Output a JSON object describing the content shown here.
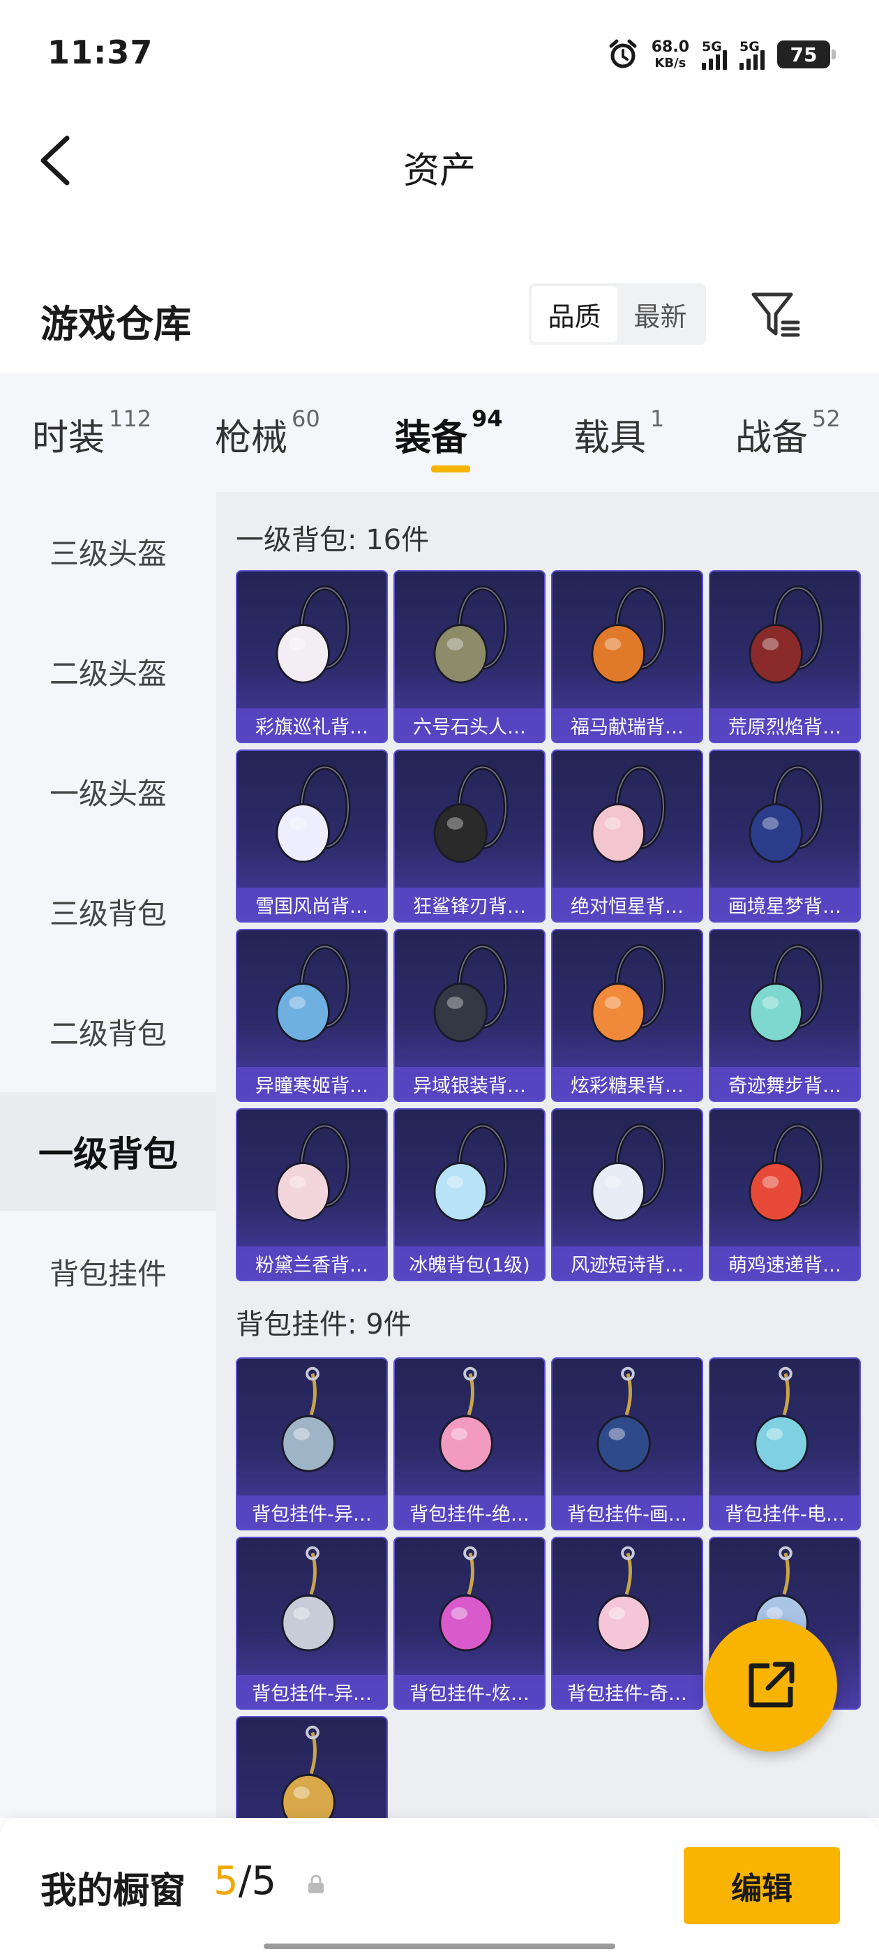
{
  "status": {
    "time": "11:37",
    "speed_value": "68.0",
    "speed_unit": "KB/s",
    "net1": "5G",
    "net2": "5G",
    "battery": "75"
  },
  "header": {
    "title": "资产"
  },
  "section": {
    "title": "游戏仓库",
    "sort_options": [
      "品质",
      "最新"
    ],
    "sort_selected": "品质"
  },
  "tabs": [
    {
      "label": "时装",
      "count": "112"
    },
    {
      "label": "枪械",
      "count": "60"
    },
    {
      "label": "装备",
      "count": "94"
    },
    {
      "label": "载具",
      "count": "1"
    },
    {
      "label": "战备",
      "count": "52"
    }
  ],
  "active_tab": "装备",
  "sidebar": [
    {
      "label": "三级头盔"
    },
    {
      "label": "二级头盔"
    },
    {
      "label": "一级头盔"
    },
    {
      "label": "三级背包"
    },
    {
      "label": "二级背包"
    },
    {
      "label": "一级背包"
    },
    {
      "label": "背包挂件"
    }
  ],
  "active_sidebar": "一级背包",
  "groups": [
    {
      "title": "一级背包: 16件",
      "items": [
        {
          "label": "彩旗巡礼背…",
          "color": "#f2eef4"
        },
        {
          "label": "六号石头人…",
          "color": "#8c8c6a"
        },
        {
          "label": "福马献瑞背…",
          "color": "#e07a2a"
        },
        {
          "label": "荒原烈焰背…",
          "color": "#8a2a2a"
        },
        {
          "label": "雪国风尚背…",
          "color": "#eeeeff"
        },
        {
          "label": "狂鲨锋刃背…",
          "color": "#2a2a2a"
        },
        {
          "label": "绝对恒星背…",
          "color": "#f3c6cf"
        },
        {
          "label": "画境星梦背…",
          "color": "#2b3c8a"
        },
        {
          "label": "异瞳寒姬背…",
          "color": "#6fb0e0"
        },
        {
          "label": "异域银装背…",
          "color": "#333844"
        },
        {
          "label": "炫彩糖果背…",
          "color": "#f08a3a"
        },
        {
          "label": "奇迹舞步背…",
          "color": "#7fd8d0"
        },
        {
          "label": "粉黛兰香背…",
          "color": "#f2d6dc"
        },
        {
          "label": "冰魄背包(1级)",
          "color": "#b8e2f6"
        },
        {
          "label": "风迹短诗背…",
          "color": "#e8ecf6"
        },
        {
          "label": "萌鸡速递背…",
          "color": "#e84a3a"
        }
      ]
    },
    {
      "title": "背包挂件: 9件",
      "items": [
        {
          "label": "背包挂件-异…",
          "color": "#9fb4c6"
        },
        {
          "label": "背包挂件-绝…",
          "color": "#f29ac0"
        },
        {
          "label": "背包挂件-画…",
          "color": "#2f4a8a"
        },
        {
          "label": "背包挂件-电…",
          "color": "#7fd0e0"
        },
        {
          "label": "背包挂件-异…",
          "color": "#c7ccd8"
        },
        {
          "label": "背包挂件-炫…",
          "color": "#d85acb"
        },
        {
          "label": "背包挂件-奇…",
          "color": "#f4c6d8"
        },
        {
          "label": "",
          "color": "#aac4e6"
        },
        {
          "label": "",
          "color": "#d8a84a"
        }
      ]
    }
  ],
  "bottom": {
    "label": "我的橱窗",
    "count_current": "5",
    "count_sep": "/5",
    "edit_label": "编辑"
  }
}
